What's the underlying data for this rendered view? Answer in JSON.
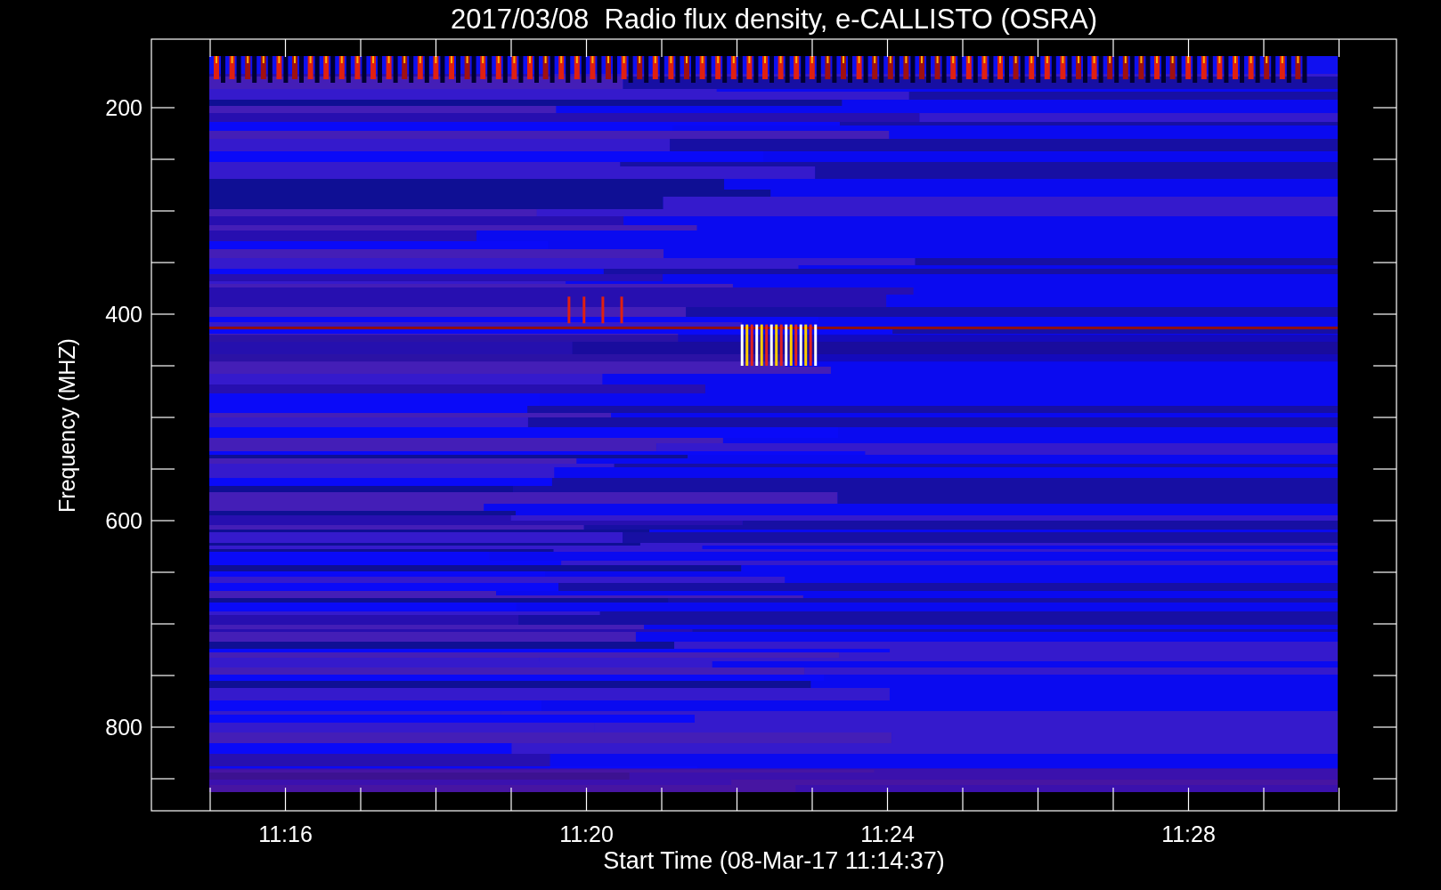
{
  "title": "2017/03/08  Radio flux density, e-CALLISTO (OSRA)",
  "y_axis": {
    "label": "Frequency (MHZ)",
    "tick_labels": [
      "200",
      "400",
      "600",
      "800"
    ]
  },
  "x_axis": {
    "label": "Start Time (08-Mar-17 11:14:37)",
    "tick_labels": [
      "11:16",
      "11:20",
      "11:24",
      "11:28"
    ]
  }
}
